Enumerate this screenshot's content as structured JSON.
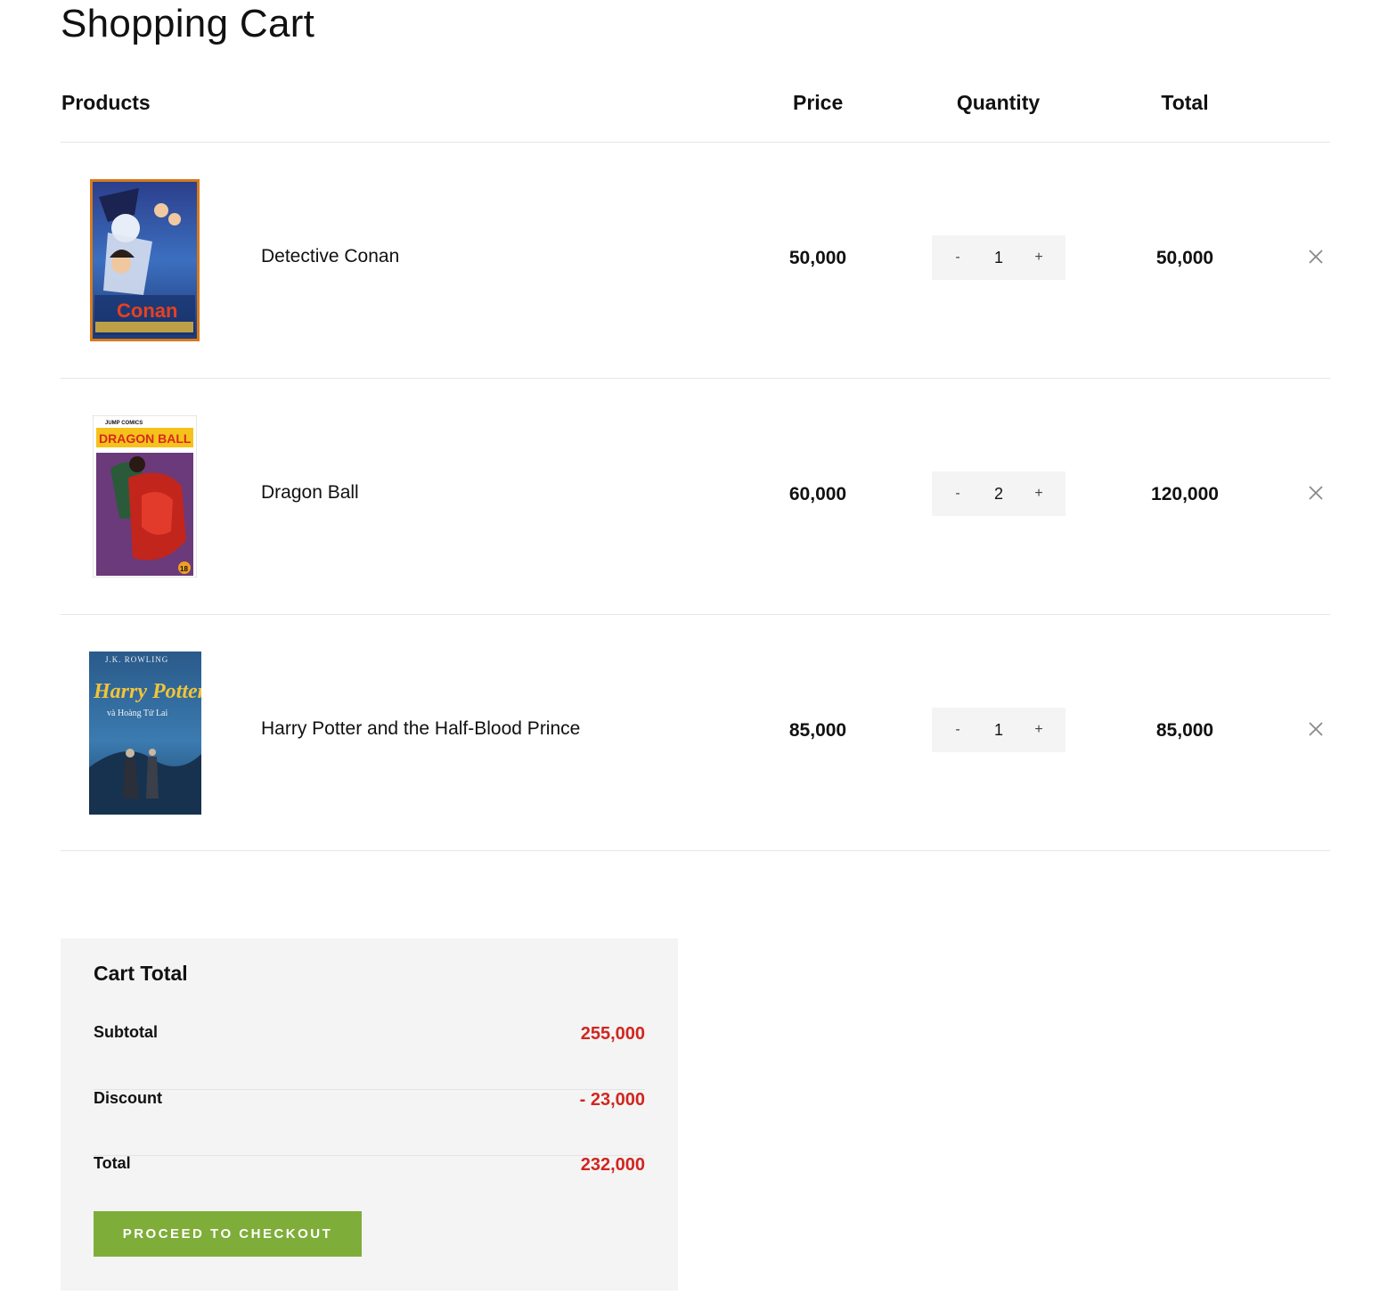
{
  "page": {
    "title": "Shopping Cart"
  },
  "table": {
    "headers": {
      "products": "Products",
      "price": "Price",
      "quantity": "Quantity",
      "total": "Total"
    }
  },
  "items": [
    {
      "name": "Detective Conan",
      "price": "50,000",
      "quantity": "1",
      "total": "50,000"
    },
    {
      "name": "Dragon Ball",
      "price": "60,000",
      "quantity": "2",
      "total": "120,000"
    },
    {
      "name": "Harry Potter and the Half-Blood Prince",
      "price": "85,000",
      "quantity": "1",
      "total": "85,000"
    }
  ],
  "controls": {
    "minus": "-",
    "plus": "+",
    "remove_icon": "close-icon"
  },
  "cover_text": {
    "conan": "Conan",
    "dragonball": "DRAGON BALL",
    "dragonball_brand": "JUMP COMICS",
    "dragonball_volume": "18",
    "hp_author": "J.K. ROWLING",
    "hp_title": "Harry Potter",
    "hp_subtitle": "và Hoàng Tử Lai"
  },
  "summary": {
    "title": "Cart Total",
    "subtotal_label": "Subtotal",
    "subtotal_value": "255,000",
    "discount_label": "Discount",
    "discount_value": "- 23,000",
    "total_label": "Total",
    "total_value": "232,000",
    "checkout_label": "PROCEED TO CHECKOUT"
  },
  "colors": {
    "accent_green": "#7fad39",
    "price_red": "#d1261f",
    "panel_bg": "#f4f4f4"
  }
}
